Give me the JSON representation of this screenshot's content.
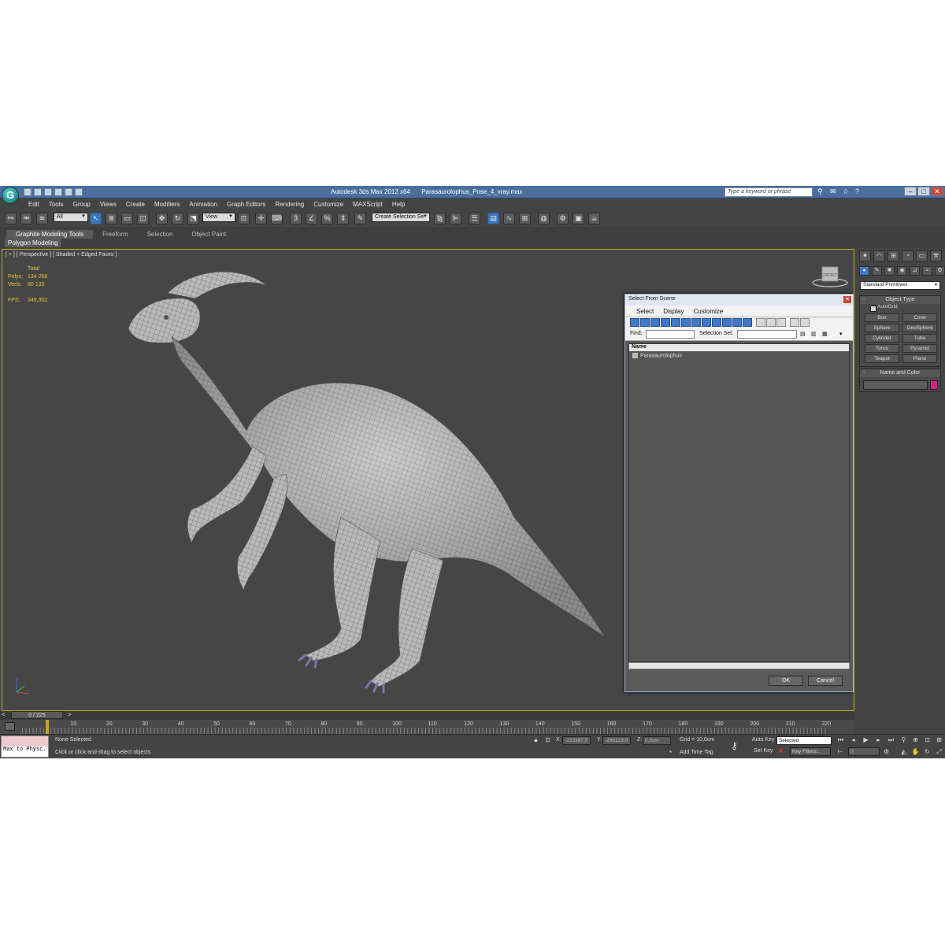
{
  "window": {
    "app_title": "Autodesk 3ds Max  2012 x64",
    "file_name": "Parasaurolophus_Pose_4_vray.max",
    "search_placeholder": "Type a keyword or phrase",
    "logo_letter": "G"
  },
  "menu": [
    "Edit",
    "Tools",
    "Group",
    "Views",
    "Create",
    "Modifiers",
    "Animation",
    "Graph Editors",
    "Rendering",
    "Customize",
    "MAXScript",
    "Help"
  ],
  "toolbar": {
    "selection_filter": "All",
    "reference_coord": "View",
    "named_selection": "Create Selection Se"
  },
  "ribbon": {
    "tabs": [
      "Graphite Modeling Tools",
      "Freeform",
      "Selection",
      "Object Paint"
    ],
    "panel": "Polygon Modeling"
  },
  "viewport": {
    "label": "[ + ] [ Perspective ] [ Shaded + Edged Faces ]",
    "stats": {
      "total_label": "Total",
      "polys_label": "Polys:",
      "polys_value": "134 268",
      "verts_label": "Verts:",
      "verts_value": "80 133",
      "fps_label": "FPS:",
      "fps_value": "349,302"
    },
    "viewcube_label": "FRONT"
  },
  "dialog": {
    "title": "Select From Scene",
    "menu": [
      "Select",
      "Display",
      "Customize"
    ],
    "find_label": "Find:",
    "selection_set_label": "Selection Set:",
    "column_name": "Name",
    "items": [
      "Parasaurolophus"
    ],
    "ok": "OK",
    "cancel": "Cancel"
  },
  "command_panel": {
    "category": "Standard Primitives",
    "object_type_title": "Object Type",
    "autogrid": "AutoGrid",
    "primitives": [
      "Box",
      "Cone",
      "Sphere",
      "GeoSphere",
      "Cylinder",
      "Tube",
      "Torus",
      "Pyramid",
      "Teapot",
      "Plane"
    ],
    "name_color_title": "Name and Color",
    "color": "#d0237f"
  },
  "timeline": {
    "frame": "0 / 225",
    "ticks": [
      "10",
      "20",
      "30",
      "40",
      "50",
      "60",
      "70",
      "80",
      "90",
      "100",
      "110",
      "120",
      "130",
      "140",
      "150",
      "160",
      "170",
      "180",
      "190",
      "200",
      "210",
      "220"
    ]
  },
  "status": {
    "maxscript": "Max to Physc.",
    "selection": "None Selected",
    "prompt": "Click or click-and-drag to select objects",
    "x_label": "X:",
    "x_value": "-223367,5",
    "y_label": "Y:",
    "y_value": "-296123,8",
    "z_label": "Z:",
    "z_value": "0,0cm",
    "grid": "Grid = 10,0cm",
    "add_time_tag": "Add Time Tag",
    "auto_key": "Auto Key",
    "selected": "Selected",
    "set_key": "Set Key",
    "key_filters": "Key Filters...",
    "frame_field": "0"
  }
}
